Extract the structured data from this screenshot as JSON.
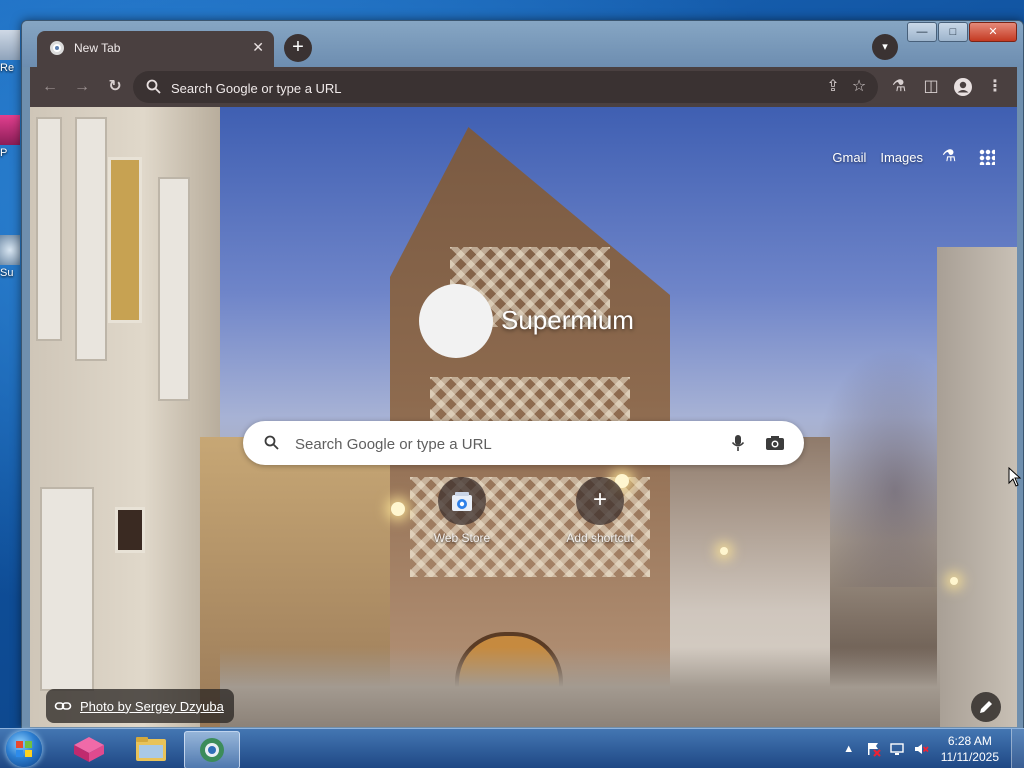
{
  "desktop": {
    "icons": [
      {
        "label": "Re"
      },
      {
        "label": "P"
      },
      {
        "label": "Su"
      }
    ]
  },
  "window": {
    "controls": {
      "minimize": "—",
      "maximize": "□",
      "close": "✕"
    }
  },
  "tab": {
    "title": "New Tab",
    "close_glyph": "✕"
  },
  "tabstrip": {
    "new_tab_glyph": "+",
    "tab_search_glyph": "▾"
  },
  "toolbar": {
    "back_glyph": "←",
    "forward_glyph": "→",
    "reload_glyph": "↻",
    "omnibox_placeholder": "Search Google or type a URL",
    "share_glyph": "⇪",
    "bookmark_glyph": "☆",
    "labs_glyph": "⚗",
    "side_panel_glyph": "◫",
    "menu_glyph": "⋮"
  },
  "ntp": {
    "links": {
      "gmail": "Gmail",
      "images": "Images"
    },
    "labs_glyph": "⚗",
    "logo_text": "Supermium",
    "search_placeholder": "Search Google or type a URL",
    "shortcuts": [
      {
        "label": "Web Store"
      },
      {
        "label": "Add shortcut",
        "glyph": "+"
      }
    ],
    "photo_credit": "Photo by Sergey Dzyuba"
  },
  "taskbar": {
    "tray_arrow": "▲",
    "time": "6:28 AM",
    "date": "11/11/2025"
  },
  "colors": {
    "tab_bg": "#4a4040",
    "omnibox_bg": "#3a3232",
    "taskbar": "#2b5fa0"
  }
}
